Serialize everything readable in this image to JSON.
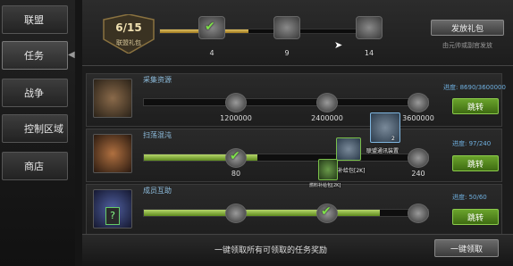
{
  "sidebar": {
    "items": [
      {
        "label": "联盟"
      },
      {
        "label": "任务"
      },
      {
        "label": "战争"
      },
      {
        "label": "控制区域"
      },
      {
        "label": "商店"
      }
    ]
  },
  "gift": {
    "count": "6/15",
    "label": "联盟礼包",
    "milestones": [
      "4",
      "9",
      "14"
    ],
    "progress_fraction": 0.4,
    "send_button": "发放礼包",
    "send_note": "由元帅或副官发放"
  },
  "tasks": [
    {
      "title": "采集资源",
      "progress": "进度: 8690/3600000",
      "nodes": [
        "1200000",
        "2400000",
        "3600000"
      ],
      "button": "跳转",
      "fill": 0.0
    },
    {
      "title": "扫荡混沌",
      "progress": "进度: 97/240",
      "nodes": [
        "80",
        "",
        "240"
      ],
      "button": "跳转",
      "fill": 0.4
    },
    {
      "title": "成员互助",
      "progress": "进度: 50/60",
      "nodes": [
        "",
        "",
        ""
      ],
      "button": "跳转",
      "fill": 0.83
    }
  ],
  "popup": {
    "item1_label": "联盟通讯装置",
    "item1_count": "2",
    "item2_label": "混装补给包[2K]",
    "item3_label": "燃料补给包[2K]"
  },
  "footer": {
    "text": "一键领取所有可领取的任务奖励",
    "button": "一键领取"
  },
  "colors": {
    "accent_green": "#6aa32c",
    "gold": "#e0c060",
    "progress_blue": "#6fb0e0"
  }
}
